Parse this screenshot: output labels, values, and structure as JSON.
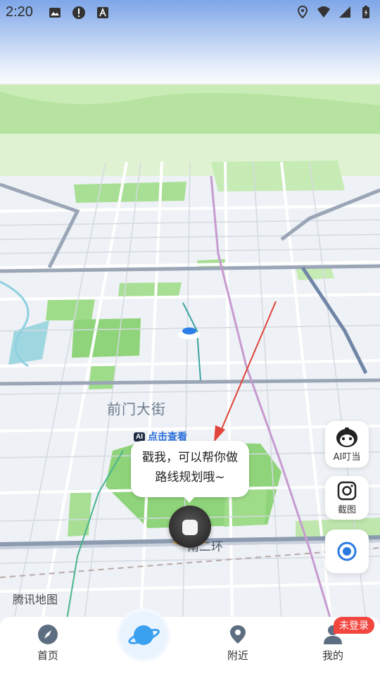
{
  "status_bar": {
    "time": "2:20",
    "left_icons": [
      "image-icon",
      "alert-icon",
      "font-icon"
    ],
    "right_icons": [
      "location-icon",
      "wifi-icon",
      "signal-icon",
      "battery-icon"
    ]
  },
  "map": {
    "street_label": "前门大街",
    "road_label": "南二环",
    "logo": "腾讯地图"
  },
  "assistant": {
    "badge": "AI",
    "hint": "点击查看",
    "bubble_line1": "戳我，可以帮你做",
    "bubble_line2": "路线规划哦~"
  },
  "float_buttons": {
    "ai_label": "AI叮当",
    "screenshot_label": "截图"
  },
  "bottom_nav": {
    "home": "首页",
    "nearby": "附近",
    "mine": "我的",
    "login_badge": "未登录"
  },
  "colors": {
    "accent": "#2a7ae2",
    "park_green": "#9fdc8a",
    "sky": "#7ea6e8",
    "badge_red": "#f2463f"
  }
}
